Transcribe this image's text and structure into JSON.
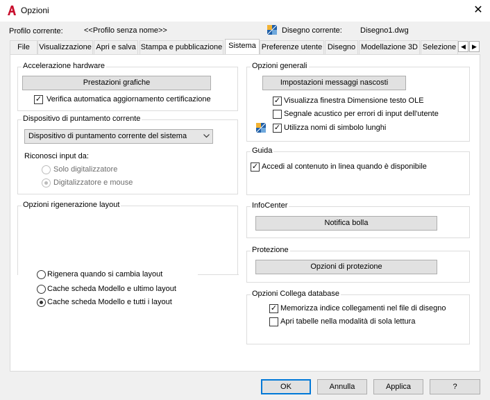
{
  "window": {
    "title": "Opzioni",
    "close_glyph": "✕",
    "app_icon": "autocad-a-icon"
  },
  "header": {
    "profile_label": "Profilo corrente:",
    "profile_value": "<<Profilo senza nome>>",
    "drawing_label": "Disegno corrente:",
    "drawing_value": "Disegno1.dwg",
    "drawing_icon": "drawing-file-icon"
  },
  "tabs": [
    {
      "label": "File"
    },
    {
      "label": "Visualizzazione"
    },
    {
      "label": "Apri e salva"
    },
    {
      "label": "Stampa e pubblicazione"
    },
    {
      "label": "Sistema"
    },
    {
      "label": "Preferenze utente"
    },
    {
      "label": "Disegno"
    },
    {
      "label": "Modellazione 3D"
    },
    {
      "label": "Selezione"
    }
  ],
  "selected_tab": "Sistema",
  "tab_scroll": {
    "left": "◀",
    "right": "▶"
  },
  "hardware": {
    "title": "Accelerazione hardware",
    "button": "Prestazioni grafiche",
    "check_label": "Verifica automatica aggiornamento certificazione",
    "checked": true
  },
  "pointing": {
    "title": "Dispositivo di puntamento corrente",
    "select_value": "Dispositivo di puntamento corrente del sistema",
    "accept_label": "Riconosci input da:",
    "options": [
      {
        "label": "Solo digitalizzatore",
        "selected": false
      },
      {
        "label": "Digitalizzatore e mouse",
        "selected": true
      }
    ]
  },
  "layout_regen": {
    "title": "Opzioni rigenerazione layout",
    "options": [
      {
        "label": "Rigenera quando si cambia layout",
        "selected": false
      },
      {
        "label": "Cache scheda Modello e ultimo layout",
        "selected": false
      },
      {
        "label": "Cache scheda Modello e tutti i layout",
        "selected": true
      }
    ]
  },
  "general": {
    "title": "Opzioni generali",
    "button": "Impostazioni messaggi nascosti",
    "checks": [
      {
        "label": "Visualizza finestra Dimensione testo OLE",
        "checked": true
      },
      {
        "label": "Segnale acustico per errori di input dell'utente",
        "checked": false
      },
      {
        "label": "Utilizza nomi di simbolo lunghi",
        "checked": true
      }
    ]
  },
  "help": {
    "title": "Guida",
    "check_label": "Accedi al contenuto in linea quando è disponibile",
    "checked": true
  },
  "infocenter": {
    "title": "InfoCenter",
    "button": "Notifica bolla"
  },
  "security": {
    "title": "Protezione",
    "button": "Opzioni di protezione"
  },
  "dblink": {
    "title": "Opzioni Collega database",
    "checks": [
      {
        "label": "Memorizza indice collegamenti nel file di disegno",
        "checked": true
      },
      {
        "label": "Apri tabelle nella modalità di sola lettura",
        "checked": false
      }
    ]
  },
  "footer": {
    "ok": "OK",
    "cancel": "Annulla",
    "apply": "Applica",
    "help": "?"
  },
  "check_glyph": "✓"
}
